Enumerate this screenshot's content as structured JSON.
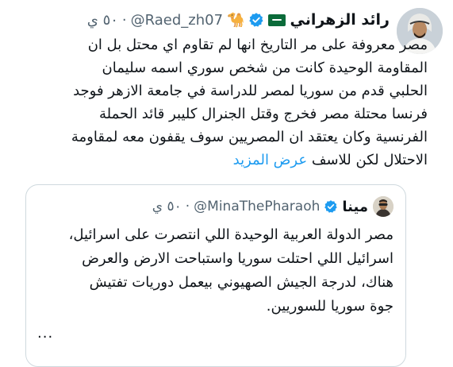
{
  "tweet": {
    "author_name": "رائد الزهراني",
    "author_emoji": "🐪",
    "handle": "@Raed_zh07",
    "time": "٥٠ ي",
    "dot": "·",
    "text_lines": [
      "مصر معروفة على مر التاريخ انها لم تقاوم اي محتل بل ان",
      "المقاومة الوحيدة كانت من شخص سوري اسمه سليمان",
      "الحلبي قدم من سوريا لمصر للدراسة في جامعة الازهر فوجد",
      "فرنسا محتلة مصر فخرج وقتل الجنرال كليبر قائد الحملة",
      "الفرنسية وكان يعتقد ان المصريين سوف يقفون معه لمقاومة",
      "الاحتلال لكن للاسف"
    ],
    "show_more_label": "عرض المزيد"
  },
  "quote": {
    "author_name": "مينا",
    "handle": "@MinaThePharaoh",
    "time": "٥٠ ي",
    "dot": "·",
    "text_lines": [
      "مصر الدولة العربية الوحيدة اللي انتصرت على اسرائيل،",
      "اسرائيل اللي احتلت سوريا واستباحت الارض والعرض",
      "هناك، لدرجة الجيش الصهيوني بيعمل دوريات تفتيش",
      "جوة سوريا للسوريين."
    ],
    "ellipsis": "..."
  },
  "colors": {
    "verified": "#1d9bf0",
    "link": "#1d9bf0",
    "muted": "#536471",
    "border": "#cfd9de",
    "flag_green": "#0b6b3a"
  },
  "icons": {
    "verified": "verified-badge-icon",
    "flag": "saudi-flag-icon",
    "camel": "camel-emoji-icon"
  }
}
